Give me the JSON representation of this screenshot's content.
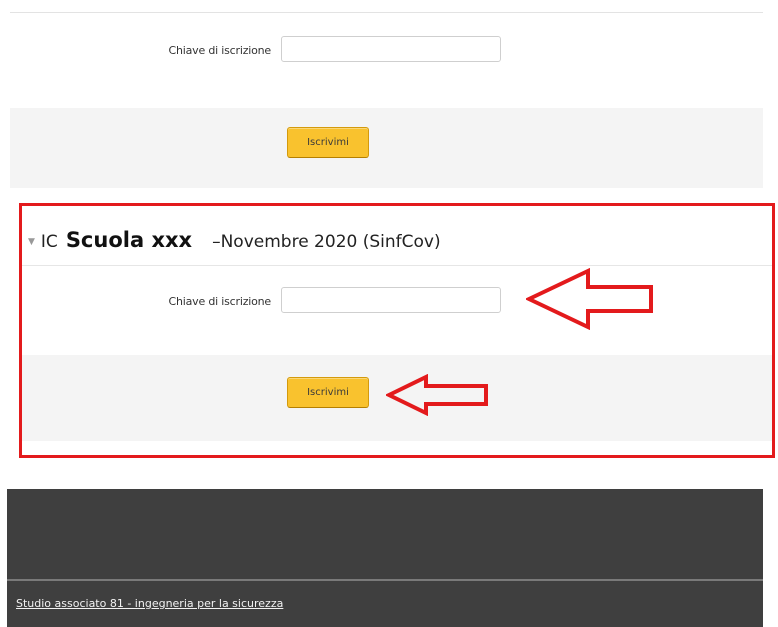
{
  "enrolment_top": {
    "key_label": "Chiave di iscrizione",
    "key_value": "",
    "button_label": "Iscrivimi"
  },
  "course": {
    "title_prefix": "IC",
    "title_school": "Scuola xxx",
    "title_suffix": "–Novembre 2020 (SinfCov)",
    "key_label": "Chiave di iscrizione",
    "key_value": "",
    "button_label": "Iscrivimi"
  },
  "annotations": {
    "highlight_color": "#e31a1c",
    "arrow_color": "#e31a1c"
  },
  "footer": {
    "link_text": "Studio associato 81 - ingegneria per la sicurezza "
  },
  "colors": {
    "button_yellow": "#f9c22e",
    "footer_bg": "#3f3f3f",
    "band_grey": "#f4f4f4"
  }
}
